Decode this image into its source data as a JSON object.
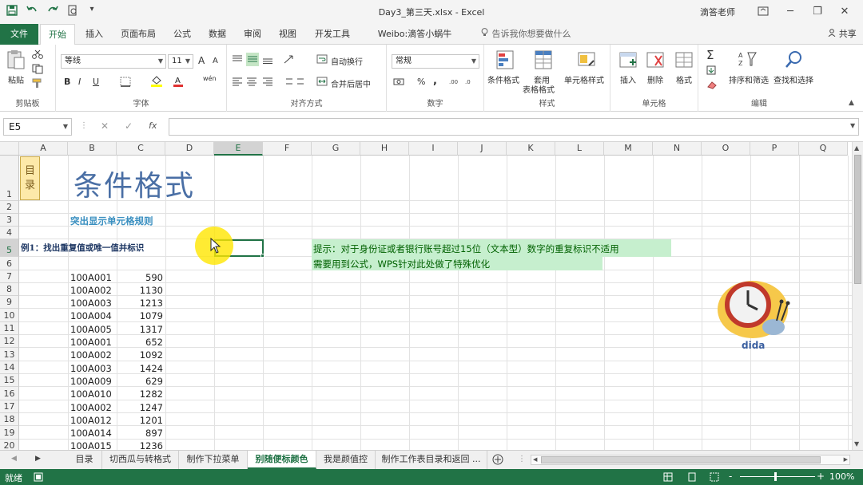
{
  "titlebar": {
    "save_icon": "save-icon",
    "undo_icon": "undo-icon",
    "redo_icon": "redo-icon",
    "doc_title": "Day3_第三天.xlsx - Excel",
    "user": "滴答老师",
    "minimize": "─",
    "restore": "❐",
    "close": "✕"
  },
  "ribbon_tabs": [
    "文件",
    "开始",
    "插入",
    "页面布局",
    "公式",
    "数据",
    "审阅",
    "视图",
    "开发工具",
    "Weibo:滴答小蜗牛"
  ],
  "tell_me": "告诉我你想要做什么",
  "share": "共享",
  "groups": {
    "clipboard": {
      "label": "剪贴板",
      "paste": "粘贴"
    },
    "font": {
      "label": "字体",
      "font_name": "等线",
      "font_size": "11",
      "bold": "B",
      "italic": "I",
      "underline": "U",
      "grow": "A",
      "shrink": "A",
      "wen": "wén"
    },
    "alignment": {
      "label": "对齐方式",
      "wrap": "自动换行",
      "merge": "合并后居中"
    },
    "number": {
      "label": "数字",
      "format": "常规",
      "percent": "%",
      "comma": ","
    },
    "styles": {
      "label": "样式",
      "cond": "条件格式",
      "table_line1": "套用",
      "table_line2": "表格格式",
      "cell_style": "单元格样式"
    },
    "cells": {
      "label": "单元格",
      "insert": "插入",
      "delete": "删除",
      "format": "格式"
    },
    "editing": {
      "label": "编辑",
      "sort": "排序和筛选",
      "find": "查找和选择",
      "sigma": "Σ"
    }
  },
  "formula_bar": {
    "name_box": "E5",
    "fx": "fx",
    "cancel": "✕",
    "enter": "✓",
    "value": ""
  },
  "columns": [
    "A",
    "B",
    "C",
    "D",
    "E",
    "F",
    "G",
    "H",
    "I",
    "J",
    "K",
    "L",
    "M",
    "N",
    "O",
    "P",
    "Q"
  ],
  "rows": [
    "1",
    "2",
    "3",
    "4",
    "5",
    "6",
    "7",
    "8",
    "9",
    "10",
    "11",
    "12",
    "13",
    "14",
    "15",
    "16",
    "17",
    "18",
    "19",
    "20"
  ],
  "cells": {
    "toc_line1": "目",
    "toc_line2": "录",
    "title": "条件格式",
    "subtitle": "突出显示单元格规则",
    "example": "例1：找出重复值或唯一值并标识",
    "tip_line1": "提示：对于身份证或者银行账号超过15位（文本型）数字的重复标识不适用",
    "tip_line2": "需要用到公式，WPS针对此处做了特殊优化",
    "logo_text": "dida"
  },
  "data_rows": [
    {
      "id": "100A001",
      "val": "590"
    },
    {
      "id": "100A002",
      "val": "1130"
    },
    {
      "id": "100A003",
      "val": "1213"
    },
    {
      "id": "100A004",
      "val": "1079"
    },
    {
      "id": "100A005",
      "val": "1317"
    },
    {
      "id": "100A001",
      "val": "652"
    },
    {
      "id": "100A002",
      "val": "1092"
    },
    {
      "id": "100A003",
      "val": "1424"
    },
    {
      "id": "100A009",
      "val": "629"
    },
    {
      "id": "100A010",
      "val": "1282"
    },
    {
      "id": "100A002",
      "val": "1247"
    },
    {
      "id": "100A012",
      "val": "1201"
    },
    {
      "id": "100A014",
      "val": "897"
    },
    {
      "id": "100A015",
      "val": "1236"
    }
  ],
  "sheet_tabs": [
    "目录",
    "切西瓜与转格式",
    "制作下拉菜单",
    "别随便标颜色",
    "我是颜值控",
    "制作工作表目录和返回 ..."
  ],
  "active_sheet_index": 3,
  "status": {
    "mode": "就绪",
    "zoom": "100%",
    "zoom_minus": "-",
    "zoom_plus": "+"
  },
  "colors": {
    "excel_green": "#217346",
    "title_blue": "#4a6fa5",
    "tip_green": "#c6efce",
    "tip_text": "#006100",
    "toc_bg": "#fde9a9"
  }
}
